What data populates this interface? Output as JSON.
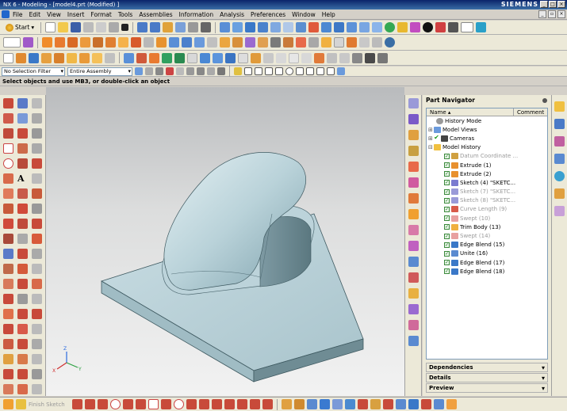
{
  "window": {
    "title": "NX 6 - Modeling - [model4.prt (Modified) ]",
    "brand": "SIEMENS"
  },
  "menu": [
    "File",
    "Edit",
    "View",
    "Insert",
    "Format",
    "Tools",
    "Assemblies",
    "Information",
    "Analysis",
    "Preferences",
    "Window",
    "Help"
  ],
  "toolbar": {
    "start_label": "Start"
  },
  "selection": {
    "filter": "No Selection Filter",
    "scope": "Entire Assembly"
  },
  "cue": "Select objects and use MB3, or double-click an object",
  "navigator": {
    "title": "Part Navigator",
    "col_name": "Name",
    "col_comment": "Comment",
    "items": [
      {
        "label": "History Mode",
        "level": 1,
        "dim": false
      },
      {
        "label": "Model Views",
        "level": 0,
        "dim": false
      },
      {
        "label": "Cameras",
        "level": 0,
        "dim": false
      },
      {
        "label": "Model History",
        "level": 0,
        "dim": false
      },
      {
        "label": "Datum Coordinate ...",
        "level": 2,
        "dim": true
      },
      {
        "label": "Extrude (1)",
        "level": 2,
        "dim": false
      },
      {
        "label": "Extrude (2)",
        "level": 2,
        "dim": false
      },
      {
        "label": "Sketch (4) \"SKETC...",
        "level": 2,
        "dim": false
      },
      {
        "label": "Sketch (7) \"SKETC...",
        "level": 2,
        "dim": true
      },
      {
        "label": "Sketch (8) \"SKETC...",
        "level": 2,
        "dim": true
      },
      {
        "label": "Curve Length (9)",
        "level": 2,
        "dim": true
      },
      {
        "label": "Swept (10)",
        "level": 2,
        "dim": true
      },
      {
        "label": "Trim Body (13)",
        "level": 2,
        "dim": false
      },
      {
        "label": "Swept (14)",
        "level": 2,
        "dim": true
      },
      {
        "label": "Edge Blend (15)",
        "level": 2,
        "dim": false
      },
      {
        "label": "Unite (16)",
        "level": 2,
        "dim": false
      },
      {
        "label": "Edge Blend (17)",
        "level": 2,
        "dim": false
      },
      {
        "label": "Edge Blend (18)",
        "level": 2,
        "dim": false
      }
    ],
    "sections": [
      "Dependencies",
      "Details",
      "Preview"
    ]
  },
  "bottom": {
    "finish_sketch": "Finish Sketch"
  },
  "axes": {
    "x": "X",
    "y": "Y",
    "z": "Z"
  }
}
